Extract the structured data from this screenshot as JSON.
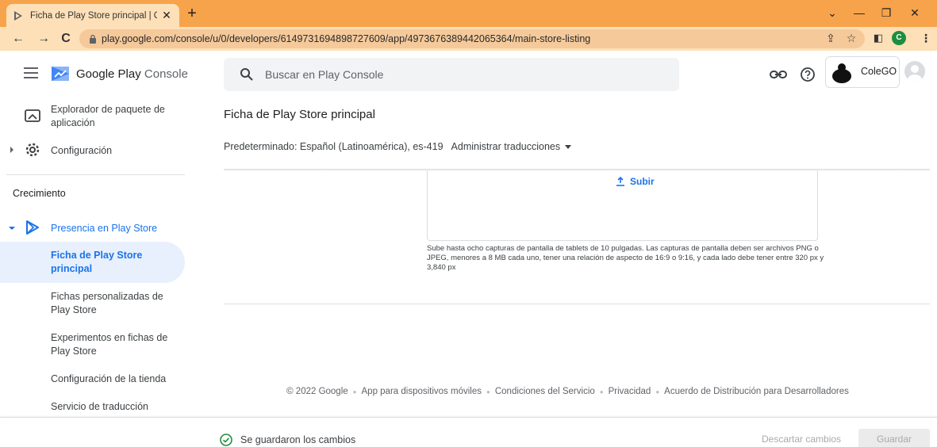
{
  "browser": {
    "tab_title": "Ficha de Play Store principal | Co",
    "url": "play.google.com/console/u/0/developers/6149731694898727609/app/4973676389442065364/main-store-listing",
    "profile_initial": "C"
  },
  "header": {
    "app_name": "Google Play",
    "app_name_suffix": "Console",
    "search_placeholder": "Buscar en Play Console",
    "account_name": "ColeGO"
  },
  "sidebar": {
    "items": [
      {
        "label": "Explorador de paquete de aplicación",
        "icon": "app-bundle-explorer-icon"
      },
      {
        "label": "Configuración",
        "icon": "gear-icon"
      }
    ],
    "section_title": "Crecimiento",
    "store_presence": {
      "label": "Presencia en Play Store",
      "icon": "play-store-icon"
    },
    "sub_items": [
      {
        "label": "Ficha de Play Store principal",
        "active": true
      },
      {
        "label": "Fichas personalizadas de Play Store"
      },
      {
        "label": "Experimentos en fichas de Play Store"
      },
      {
        "label": "Configuración de la tienda"
      },
      {
        "label": "Servicio de traducción"
      }
    ]
  },
  "main": {
    "page_title": "Ficha de Play Store principal",
    "default_language": "Predeterminado: Español (Latinoamérica), es-419",
    "manage_translations": "Administrar traducciones",
    "upload_label": "Subir",
    "upload_help": "Sube hasta ocho capturas de pantalla de tablets de 10 pulgadas. Las capturas de pantalla deben ser archivos PNG o JPEG, menores a 8 MB cada uno, tener una relación de aspecto de 16:9 o 9:16, y cada lado debe tener entre 320 px y 3,840 px"
  },
  "footer": {
    "copyright": "© 2022 Google",
    "links": [
      "App para dispositivos móviles",
      "Condiciones del Servicio",
      "Privacidad",
      "Acuerdo de Distribución para Desarrolladores"
    ]
  },
  "bottom_bar": {
    "status": "Se guardaron los cambios",
    "discard_label": "Descartar cambios",
    "save_label": "Guardar"
  },
  "colors": {
    "chrome_orange": "#f7a34b",
    "accent_blue": "#1a73e8",
    "active_bg": "#e8f0fe",
    "success_green": "#1e8e3e"
  }
}
